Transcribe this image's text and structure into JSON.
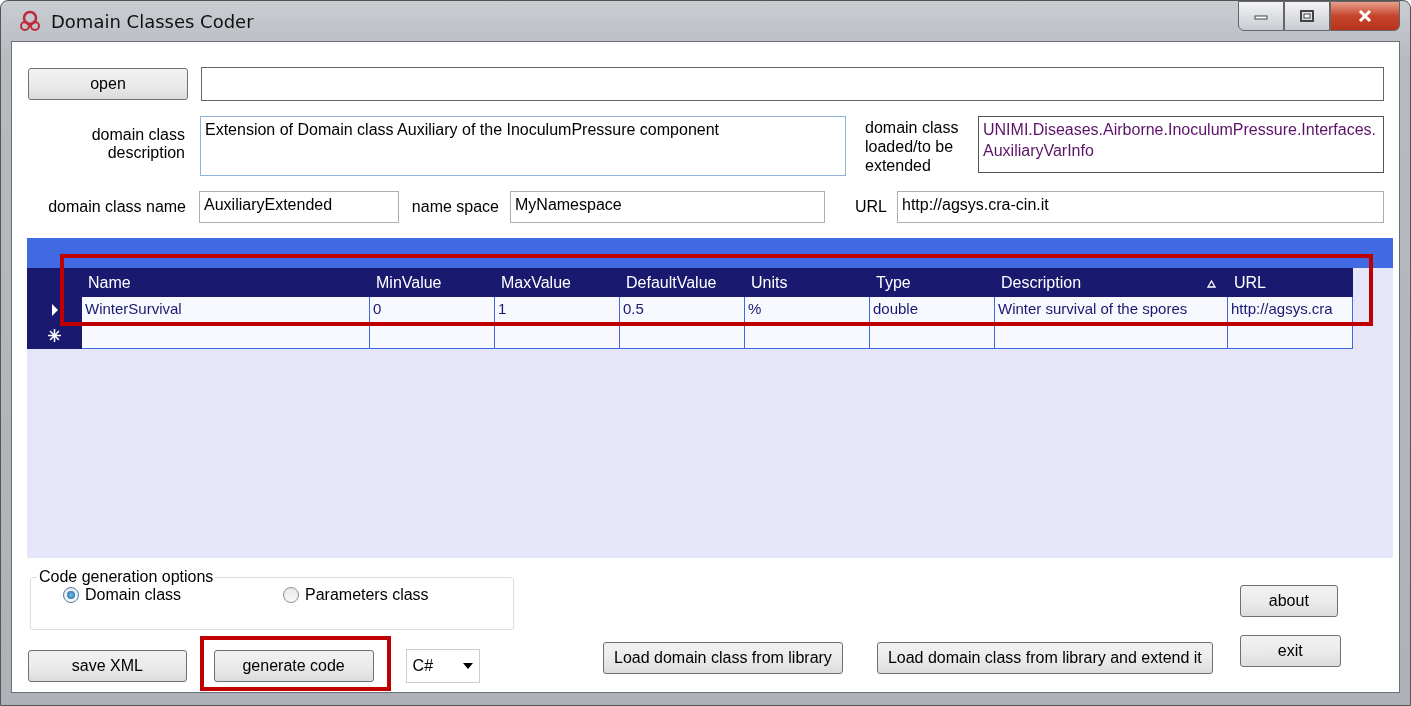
{
  "window": {
    "title": "Domain Classes Coder"
  },
  "open_button": {
    "label": "open"
  },
  "description": {
    "label": "domain class description",
    "value": "Extension of Domain class Auxiliary of the InoculumPressure component"
  },
  "loaded_class": {
    "label": "domain class loaded/to be extended",
    "value": "UNIMI.Diseases.Airborne.InoculumPressure.Interfaces.AuxiliaryVarInfo"
  },
  "class_name": {
    "label": "domain class name",
    "value": "AuxiliaryExtended"
  },
  "name_space": {
    "label": "name space",
    "value": "MyNamespace"
  },
  "url": {
    "label": "URL",
    "value": "http://agsys.cra-cin.it"
  },
  "grid": {
    "highlighted": true,
    "columns": [
      {
        "label": "Name",
        "sorted": false
      },
      {
        "label": "MinValue",
        "sorted": false
      },
      {
        "label": "MaxValue",
        "sorted": false
      },
      {
        "label": "DefaultValue",
        "sorted": false
      },
      {
        "label": "Units",
        "sorted": false
      },
      {
        "label": "Type",
        "sorted": false
      },
      {
        "label": "Description",
        "sorted": true
      },
      {
        "label": "URL",
        "sorted": false
      }
    ],
    "rows": [
      {
        "kind": "data",
        "selected": true,
        "cells": [
          "WinterSurvival",
          "0",
          "1",
          "0.5",
          "%",
          "double",
          "Winter survival of the spores",
          "http://agsys.cra"
        ]
      },
      {
        "kind": "new",
        "selected": false,
        "cells": []
      }
    ]
  },
  "code_options": {
    "title": "Code generation options",
    "options": [
      {
        "label": "Domain class",
        "selected": true
      },
      {
        "label": "Parameters class",
        "selected": false
      }
    ]
  },
  "save_button": {
    "label": "save XML"
  },
  "generate_button": {
    "label": "generate code",
    "highlighted": true
  },
  "language": {
    "value": "C#"
  },
  "load_button": {
    "label": "Load domain class from library"
  },
  "load_extend_button": {
    "label": "Load domain class from library and extend it"
  },
  "about_button": {
    "label": "about"
  },
  "exit_button": {
    "label": "exit"
  }
}
